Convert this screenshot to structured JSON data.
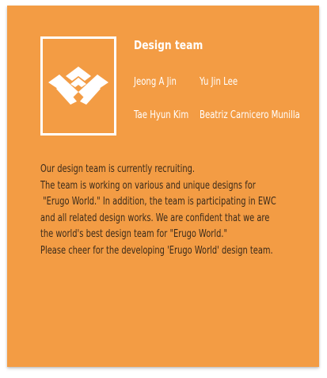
{
  "team": {
    "title": "Design team",
    "logo_icon": "erugo-world-logo-icon",
    "members": [
      "Jeong A Jin",
      "Yu Jin Lee",
      "Tae Hyun Kim",
      "Beatriz Carnicero Munilla"
    ]
  },
  "description": {
    "lines": [
      "Our design team is currently recruiting.",
      "The team is working on various and unique designs for",
      " \"Erugo World.\" In addition, the team is participating in EWC",
      "and all related design works. We are confident that we are",
      "the world's best design team for \"Erugo World.\"",
      "Please cheer for the developing 'Erugo World' design team."
    ]
  },
  "colors": {
    "card_background": "#f39c44",
    "heading_text": "#ffffff",
    "body_text": "#3a2a1a"
  }
}
